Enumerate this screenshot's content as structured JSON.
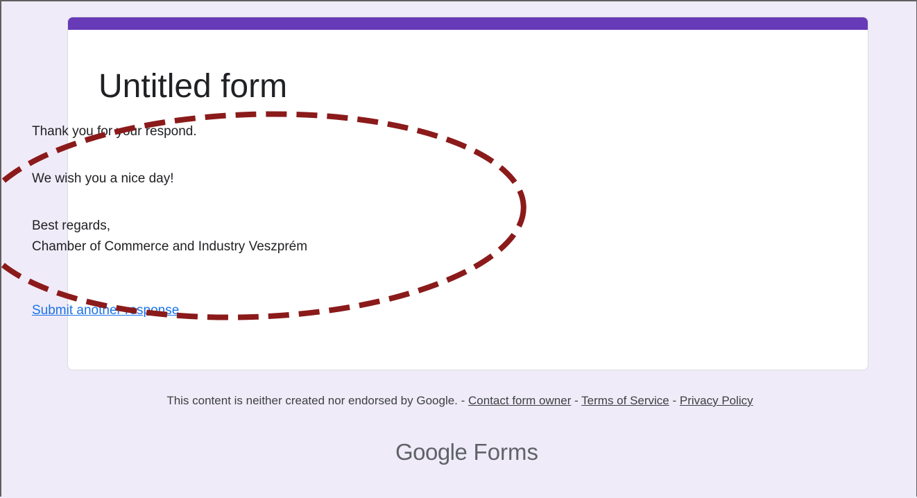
{
  "form": {
    "title": "Untitled form",
    "accent_color": "#673ab7",
    "background_color": "#f0ebf8"
  },
  "confirmation": {
    "line1": "Thank you for your respond.",
    "line2": "We wish you a nice day!",
    "line3": "Best regards,",
    "line4": "Chamber of Commerce and Industry Veszprém"
  },
  "submit_another": {
    "label": "Submit another response",
    "color": "#1a73e8"
  },
  "annotation": {
    "shape": "dashed-ellipse",
    "color": "#8b1a1a"
  },
  "footer": {
    "disclaimer": "This content is neither created nor endorsed by Google.",
    "separator": " - ",
    "contact_link": "Contact form owner",
    "terms_link": "Terms of Service",
    "privacy_link": "Privacy Policy"
  },
  "brand": {
    "google": "Google",
    "forms": "Forms"
  }
}
